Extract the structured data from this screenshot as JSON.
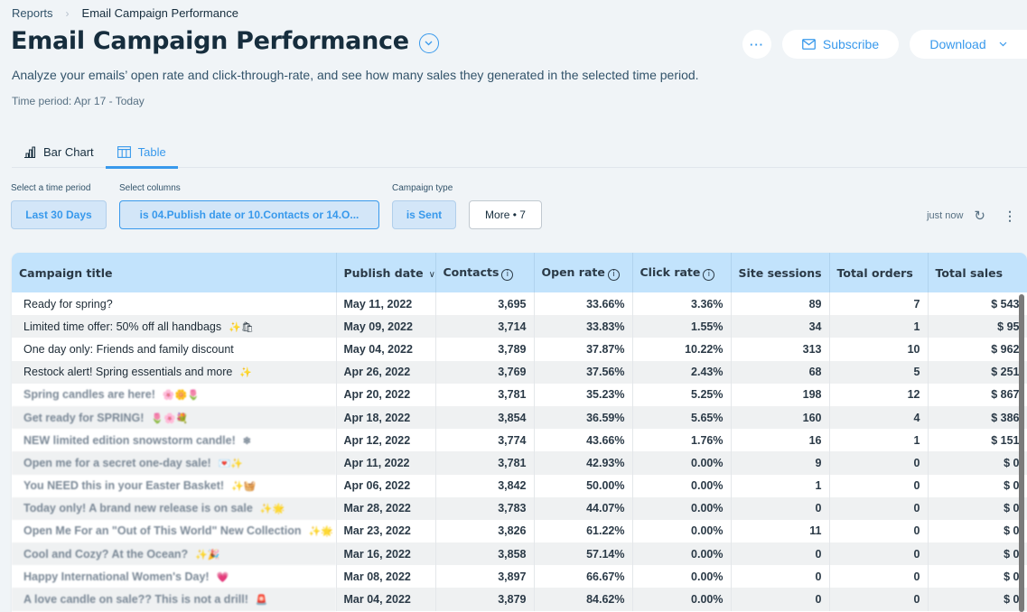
{
  "breadcrumb": {
    "parent": "Reports",
    "separator": "›",
    "current": "Email Campaign Performance"
  },
  "header": {
    "title": "Email Campaign Performance",
    "description": "Analyze your emails’ open rate and click-through-rate, and see how many sales they generated in the selected time period.",
    "time_period": "Time period: Apr 17 - Today",
    "more_label": "···",
    "subscribe_label": "Subscribe",
    "download_label": "Download"
  },
  "tabs": [
    {
      "label": "Bar Chart",
      "icon": "bar-chart-icon",
      "active": false
    },
    {
      "label": "Table",
      "icon": "table-icon",
      "active": true
    }
  ],
  "filters": {
    "time_period": {
      "label": "Select a time period",
      "value": "Last 30 Days"
    },
    "columns": {
      "label": "Select columns",
      "value": "is 04.Publish date or 10.Contacts or 14.O..."
    },
    "campaign_type": {
      "label": "Campaign type",
      "value": "is Sent"
    },
    "more": {
      "value": "More • 7"
    }
  },
  "status": {
    "updated": "just now"
  },
  "table": {
    "columns": [
      "Campaign title",
      "Publish date",
      "Contacts",
      "Open rate",
      "Click rate",
      "Site sessions",
      "Total orders",
      "Total sales"
    ],
    "rows": [
      {
        "title": "Ready for spring?",
        "emoji": "",
        "blurred": false,
        "date": "May 11, 2022",
        "contacts": "3,695",
        "open_rate": "33.66%",
        "click_rate": "3.36%",
        "sessions": "89",
        "orders": "7",
        "sales": "$ 543"
      },
      {
        "title": "Limited time offer: 50% off all handbags",
        "emoji": "✨🛍",
        "blurred": false,
        "date": "May 09, 2022",
        "contacts": "3,714",
        "open_rate": "33.83%",
        "click_rate": "1.55%",
        "sessions": "34",
        "orders": "1",
        "sales": "$ 95"
      },
      {
        "title": "One day only: Friends and family discount",
        "emoji": "",
        "blurred": false,
        "date": "May 04, 2022",
        "contacts": "3,789",
        "open_rate": "37.87%",
        "click_rate": "10.22%",
        "sessions": "313",
        "orders": "10",
        "sales": "$ 962"
      },
      {
        "title": "Restock alert! Spring essentials and more",
        "emoji": "✨",
        "blurred": false,
        "date": "Apr 26, 2022",
        "contacts": "3,769",
        "open_rate": "37.56%",
        "click_rate": "2.43%",
        "sessions": "68",
        "orders": "5",
        "sales": "$ 251"
      },
      {
        "title": "Spring candles are here!",
        "emoji": "🌸🌼🌷",
        "blurred": true,
        "date": "Apr 20, 2022",
        "contacts": "3,781",
        "open_rate": "35.23%",
        "click_rate": "5.25%",
        "sessions": "198",
        "orders": "12",
        "sales": "$ 867"
      },
      {
        "title": "Get ready for SPRING!",
        "emoji": "🌷🌸💐",
        "blurred": true,
        "date": "Apr 18, 2022",
        "contacts": "3,854",
        "open_rate": "36.59%",
        "click_rate": "5.65%",
        "sessions": "160",
        "orders": "4",
        "sales": "$ 386"
      },
      {
        "title": "NEW limited edition snowstorm candle!",
        "emoji": "❄",
        "blurred": true,
        "date": "Apr 12, 2022",
        "contacts": "3,774",
        "open_rate": "43.66%",
        "click_rate": "1.76%",
        "sessions": "16",
        "orders": "1",
        "sales": "$ 151"
      },
      {
        "title": "Open me for a secret one-day sale!",
        "emoji": "💌✨",
        "blurred": true,
        "date": "Apr 11, 2022",
        "contacts": "3,781",
        "open_rate": "42.93%",
        "click_rate": "0.00%",
        "sessions": "9",
        "orders": "0",
        "sales": "$ 0"
      },
      {
        "title": "You NEED this in your Easter Basket!",
        "emoji": "✨🧺",
        "blurred": true,
        "date": "Apr 06, 2022",
        "contacts": "3,842",
        "open_rate": "50.00%",
        "click_rate": "0.00%",
        "sessions": "1",
        "orders": "0",
        "sales": "$ 0"
      },
      {
        "title": "Today only! A brand new release is on sale",
        "emoji": "✨🌟",
        "blurred": true,
        "date": "Mar 28, 2022",
        "contacts": "3,783",
        "open_rate": "44.07%",
        "click_rate": "0.00%",
        "sessions": "0",
        "orders": "0",
        "sales": "$ 0"
      },
      {
        "title": "Open Me For an \"Out of This World\" New Collection",
        "emoji": "✨🌟",
        "blurred": true,
        "date": "Mar 23, 2022",
        "contacts": "3,826",
        "open_rate": "61.22%",
        "click_rate": "0.00%",
        "sessions": "11",
        "orders": "0",
        "sales": "$ 0"
      },
      {
        "title": "Cool and Cozy? At the Ocean?",
        "emoji": "✨🎉",
        "blurred": true,
        "date": "Mar 16, 2022",
        "contacts": "3,858",
        "open_rate": "57.14%",
        "click_rate": "0.00%",
        "sessions": "0",
        "orders": "0",
        "sales": "$ 0"
      },
      {
        "title": "Happy International Women's Day!",
        "emoji": "💗",
        "blurred": true,
        "date": "Mar 08, 2022",
        "contacts": "3,897",
        "open_rate": "66.67%",
        "click_rate": "0.00%",
        "sessions": "0",
        "orders": "0",
        "sales": "$ 0"
      },
      {
        "title": "A love candle on sale?? This is not a drill!",
        "emoji": "🚨",
        "blurred": true,
        "date": "Mar 04, 2022",
        "contacts": "3,879",
        "open_rate": "84.62%",
        "click_rate": "0.00%",
        "sessions": "0",
        "orders": "0",
        "sales": "$ 0"
      }
    ]
  },
  "colors": {
    "accent": "#3899ec",
    "header_bg": "#c2e3fc",
    "page_bg": "#f0f4f7",
    "text": "#162d3d"
  }
}
